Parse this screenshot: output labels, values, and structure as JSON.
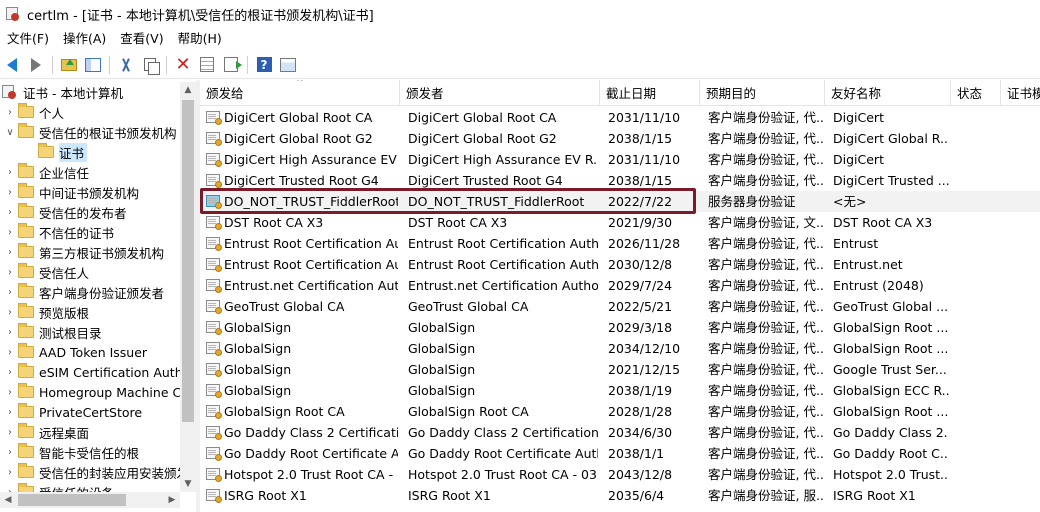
{
  "window": {
    "title": "certlm - [证书 - 本地计算机\\受信任的根证书颁发机构\\证书]"
  },
  "menu": {
    "items": [
      "文件(F)",
      "操作(A)",
      "查看(V)",
      "帮助(H)"
    ]
  },
  "toolbar": {
    "icons": [
      "back-icon",
      "forward-icon",
      "up-folder-icon",
      "show-tree-icon",
      "cut-icon",
      "copy-icon",
      "delete-icon",
      "properties-icon",
      "export-icon",
      "help-icon",
      "view-icon"
    ]
  },
  "tree": {
    "root": "证书 - 本地计算机",
    "items": [
      {
        "label": "个人",
        "level": 1,
        "expander": ">"
      },
      {
        "label": "受信任的根证书颁发机构",
        "level": 1,
        "expander": "v"
      },
      {
        "label": "证书",
        "level": 2,
        "expander": ""
      },
      {
        "label": "企业信任",
        "level": 1,
        "expander": ">"
      },
      {
        "label": "中间证书颁发机构",
        "level": 1,
        "expander": ">"
      },
      {
        "label": "受信任的发布者",
        "level": 1,
        "expander": ">"
      },
      {
        "label": "不信任的证书",
        "level": 1,
        "expander": ">"
      },
      {
        "label": "第三方根证书颁发机构",
        "level": 1,
        "expander": ">"
      },
      {
        "label": "受信任人",
        "level": 1,
        "expander": ">"
      },
      {
        "label": "客户端身份验证颁发者",
        "level": 1,
        "expander": ">"
      },
      {
        "label": "预览版根",
        "level": 1,
        "expander": ">"
      },
      {
        "label": "测试根目录",
        "level": 1,
        "expander": ">"
      },
      {
        "label": "AAD Token Issuer",
        "level": 1,
        "expander": ">"
      },
      {
        "label": "eSIM Certification Autho",
        "level": 1,
        "expander": ">"
      },
      {
        "label": "Homegroup Machine C",
        "level": 1,
        "expander": ">"
      },
      {
        "label": "PrivateCertStore",
        "level": 1,
        "expander": ">"
      },
      {
        "label": "远程桌面",
        "level": 1,
        "expander": ">"
      },
      {
        "label": "智能卡受信任的根",
        "level": 1,
        "expander": ">"
      },
      {
        "label": "受信任的封装应用安装颁发",
        "level": 1,
        "expander": ">"
      },
      {
        "label": "受信任的设备",
        "level": 1,
        "expander": ">"
      }
    ]
  },
  "list": {
    "columns": [
      "颁发给",
      "颁发者",
      "截止日期",
      "预期目的",
      "友好名称",
      "状态",
      "证书模"
    ],
    "rows": [
      [
        "DigiCert Global Root CA",
        "DigiCert Global Root CA",
        "2031/11/10",
        "客户端身份验证, 代...",
        "DigiCert"
      ],
      [
        "DigiCert Global Root G2",
        "DigiCert Global Root G2",
        "2038/1/15",
        "客户端身份验证, 代...",
        "DigiCert Global R..."
      ],
      [
        "DigiCert High Assurance EV ...",
        "DigiCert High Assurance EV R...",
        "2031/11/10",
        "客户端身份验证, 代...",
        "DigiCert"
      ],
      [
        "DigiCert Trusted Root G4",
        "DigiCert Trusted Root G4",
        "2038/1/15",
        "客户端身份验证, 代...",
        "DigiCert Trusted ..."
      ],
      [
        "DO_NOT_TRUST_FiddlerRoot",
        "DO_NOT_TRUST_FiddlerRoot",
        "2022/7/22",
        "服务器身份验证",
        "<无>"
      ],
      [
        "DST Root CA X3",
        "DST Root CA X3",
        "2021/9/30",
        "客户端身份验证, 文...",
        "DST Root CA X3"
      ],
      [
        "Entrust Root Certification Au...",
        "Entrust Root Certification Auth...",
        "2026/11/28",
        "客户端身份验证, 代...",
        "Entrust"
      ],
      [
        "Entrust Root Certification Au...",
        "Entrust Root Certification Auth...",
        "2030/12/8",
        "客户端身份验证, 代...",
        "Entrust.net"
      ],
      [
        "Entrust.net Certification Auth...",
        "Entrust.net Certification Author...",
        "2029/7/24",
        "客户端身份验证, 代...",
        "Entrust (2048)"
      ],
      [
        "GeoTrust Global CA",
        "GeoTrust Global CA",
        "2022/5/21",
        "客户端身份验证, 代...",
        "GeoTrust Global ..."
      ],
      [
        "GlobalSign",
        "GlobalSign",
        "2029/3/18",
        "客户端身份验证, 代...",
        "GlobalSign Root ..."
      ],
      [
        "GlobalSign",
        "GlobalSign",
        "2034/12/10",
        "客户端身份验证, 代...",
        "GlobalSign Root ..."
      ],
      [
        "GlobalSign",
        "GlobalSign",
        "2021/12/15",
        "客户端身份验证, 代...",
        "Google Trust Ser..."
      ],
      [
        "GlobalSign",
        "GlobalSign",
        "2038/1/19",
        "客户端身份验证, 代...",
        "GlobalSign ECC R..."
      ],
      [
        "GlobalSign Root CA",
        "GlobalSign Root CA",
        "2028/1/28",
        "客户端身份验证, 代...",
        "GlobalSign Root ..."
      ],
      [
        "Go Daddy Class 2 Certificati...",
        "Go Daddy Class 2 Certification...",
        "2034/6/30",
        "客户端身份验证, 代...",
        "Go Daddy Class 2..."
      ],
      [
        "Go Daddy Root Certificate A...",
        "Go Daddy Root Certificate Auth...",
        "2038/1/1",
        "客户端身份验证, 代...",
        "Go Daddy Root C..."
      ],
      [
        "Hotspot 2.0 Trust Root CA - ...",
        "Hotspot 2.0 Trust Root CA - 03",
        "2043/12/8",
        "客户端身份验证, 代...",
        "Hotspot 2.0 Trust..."
      ],
      [
        "ISRG Root X1",
        "ISRG Root X1",
        "2035/6/4",
        "客户端身份验证, 服...",
        "ISRG Root X1"
      ]
    ],
    "selected_index": 4
  }
}
